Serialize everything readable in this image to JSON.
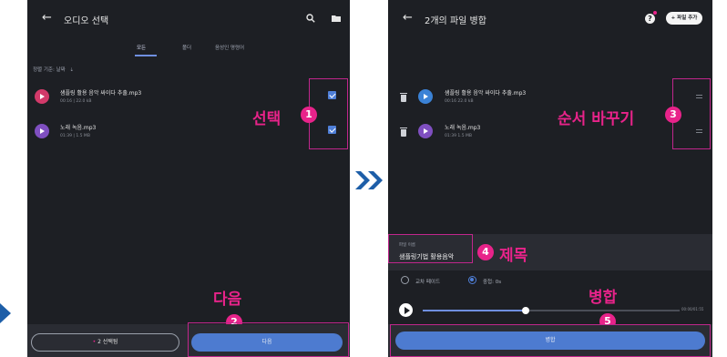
{
  "left": {
    "back_glyph": "←",
    "title": "오디오 선택",
    "icons": [
      "search-icon",
      "folder-icon"
    ],
    "tabs": [
      {
        "label": "모든",
        "active": true
      },
      {
        "label": "폴더",
        "active": false
      },
      {
        "label": "음성인 명령어",
        "active": false
      }
    ],
    "sort_label": "정렬 기준: 날짜",
    "sort_arrow": "⇣",
    "files": [
      {
        "name": "샘플링 활용 음악 싸이다 추출.mp3",
        "meta": "00:16 | 22.0 kB",
        "color": "#d23a6a",
        "checked": true
      },
      {
        "name": "노래 녹음.mp3",
        "meta": "01:39 | 1.5 MB",
        "color": "#7f4fc0",
        "checked": true
      }
    ],
    "selected_button": "2 선택됨",
    "selected_dot": "•",
    "next_button": "다음"
  },
  "right": {
    "back_glyph": "←",
    "title": "2개의 파일 병합",
    "help_glyph": "?",
    "add_file_button": "+ 파일 추가",
    "files": [
      {
        "name": "샘플링 활용 음악 싸이다 추출.mp3",
        "meta": "00:16  22.0 kB",
        "color": "#3b82d6"
      },
      {
        "name": "노래 녹음.mp3",
        "meta": "01:39  1.5 MB",
        "color": "#7f4fc0"
      }
    ],
    "filename_label": "파일 이름",
    "filename_value": "샘플링기법 활용음악",
    "radio_options": [
      {
        "label": "교차 페이드",
        "selected": false
      },
      {
        "label": "중첩: 0s",
        "selected": true
      }
    ],
    "playback_progress": 0.4,
    "time": "00:00/01:55",
    "merge_button": "병합"
  },
  "annotations": {
    "select": {
      "text": "선택",
      "num": "1"
    },
    "next": {
      "text": "다음",
      "num": "2"
    },
    "reorder": {
      "text": "순서 바꾸기",
      "num": "3"
    },
    "title": {
      "text": "제목",
      "num": "4"
    },
    "merge": {
      "text": "병합",
      "num": "5"
    }
  },
  "colors": {
    "accent": "#e8238a",
    "primary": "#4d7bd0",
    "bg": "#1d1f24",
    "arrow": "#1d5ea8"
  }
}
